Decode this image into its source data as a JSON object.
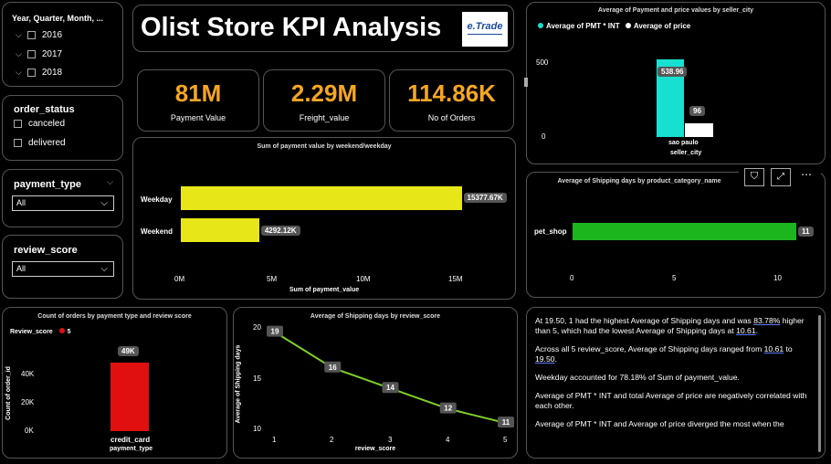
{
  "slicers": {
    "date": {
      "title": "Year, Quarter, Month, ...",
      "items": [
        "2016",
        "2017",
        "2018"
      ]
    },
    "order_status": {
      "title": "order_status",
      "items": [
        "canceled",
        "delivered"
      ]
    },
    "payment_type": {
      "title": "payment_type",
      "value": "All"
    },
    "review_score": {
      "title": "review_score",
      "value": "All"
    }
  },
  "header": {
    "title": "Olist Store KPI Analysis",
    "logo_text": "e.Trade"
  },
  "kpis": [
    {
      "value": "81M",
      "label": "Payment Value"
    },
    {
      "value": "2.29M",
      "label": "Freight_value"
    },
    {
      "value": "114.86K",
      "label": "No of Orders"
    }
  ],
  "weekend_chart": {
    "title": "Sum of payment value by weekend/weekday",
    "xlabel": "Sum of payment_value",
    "ticks": [
      "0M",
      "5M",
      "10M",
      "15M"
    ],
    "chart_data": {
      "type": "bar",
      "categories": [
        "Weekday",
        "Weekend"
      ],
      "values": [
        15377.67,
        4292.12
      ],
      "data_labels": [
        "15377.67K",
        "4292.12K"
      ],
      "xlim": [
        0,
        15500
      ],
      "color": "#e6e619"
    }
  },
  "city_chart": {
    "title": "Average of Payment and price values by seller_city",
    "xlabel": "seller_city",
    "legend": [
      "Average of PMT * INT",
      "Average of price"
    ],
    "ticks": [
      "500",
      "0"
    ],
    "chart_data": {
      "type": "bar",
      "categories": [
        "sao paulo"
      ],
      "series": [
        {
          "name": "Average of PMT * INT",
          "values": [
            538.96
          ],
          "color": "#18e0d0"
        },
        {
          "name": "Average of price",
          "values": [
            96
          ],
          "color": "#ffffff"
        }
      ],
      "data_labels": [
        "538.96",
        "96"
      ],
      "ylim": [
        0,
        600
      ]
    }
  },
  "shipping_category_chart": {
    "title": "Average of Shipping days by product_category_name",
    "ticks": [
      "0",
      "5",
      "10"
    ],
    "chart_data": {
      "type": "bar",
      "categories": [
        "pet_shop"
      ],
      "values": [
        11
      ],
      "data_labels": [
        "11"
      ],
      "xlim": [
        0,
        12
      ],
      "color": "#1db51d"
    }
  },
  "payment_review_chart": {
    "title": "Count of orders by payment type and review score",
    "legend_title": "Review_score",
    "legend_item": "5",
    "ylabel": "Count of order_id",
    "xlabel": "payment_type",
    "ticks": [
      "40K",
      "20K",
      "0K"
    ],
    "chart_data": {
      "type": "bar",
      "categories": [
        "credit_card"
      ],
      "values": [
        49
      ],
      "data_labels": [
        "49K"
      ],
      "ylim": [
        0,
        50
      ],
      "color": "#e01010"
    }
  },
  "review_line_chart": {
    "title": "Average of Shipping days by review_score",
    "ylabel": "Average of Shipping days",
    "xlabel": "review_score",
    "yticks": [
      "20",
      "15",
      "10"
    ],
    "xticks": [
      "1",
      "2",
      "3",
      "4",
      "5"
    ],
    "chart_data": {
      "type": "line",
      "x": [
        1,
        2,
        3,
        4,
        5
      ],
      "y": [
        19.5,
        16,
        14,
        12,
        10.61
      ],
      "data_labels": [
        "19",
        "16",
        "14",
        "12",
        "11"
      ],
      "ylim": [
        10,
        20
      ],
      "color": "#7fcf2a"
    }
  },
  "narrative": {
    "p1_a": "At 19.50, 1 had the highest Average of Shipping days and was ",
    "p1_b": "83.78%",
    "p1_c": " higher than 5, which had the lowest Average of Shipping days at ",
    "p1_d": "10.61",
    "p1_e": ".",
    "p2_a": "Across all 5 review_score, Average of Shipping days ranged from ",
    "p2_b": "10.61",
    "p2_c": " to ",
    "p2_d": "19.50",
    "p2_e": ".",
    "p3": "Weekday accounted for 78.18% of Sum of payment_value.",
    "p4": "Average of PMT * INT and total Average of price are negatively correlated with each other.",
    "p5": "Average of PMT * INT and Average of price diverged the most when the"
  },
  "toolbar_icons": [
    "filter-icon",
    "focus-mode-icon",
    "more-options-icon"
  ]
}
